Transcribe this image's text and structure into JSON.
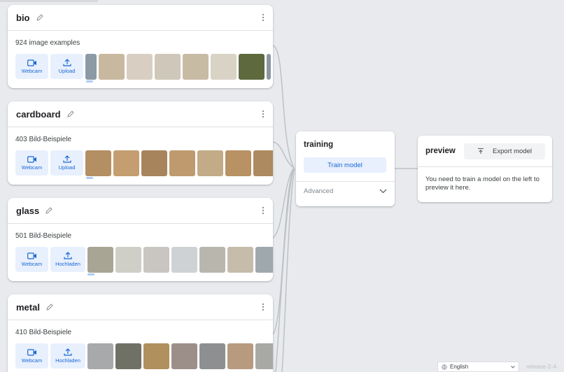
{
  "classes": [
    {
      "name": "bio",
      "count": "924 image examples",
      "webcam": "Webcam",
      "upload": "Upload",
      "thumbs": [
        "#8c9aa6",
        "#c9b8a0",
        "#d8cfc2",
        "#cfc7b9",
        "#c8bba4",
        "#d9d3c6",
        "#5e6a3e",
        "#8b97a0"
      ]
    },
    {
      "name": "cardboard",
      "count": "403 Bild-Beispiele",
      "webcam": "Webcam",
      "upload": "Upload",
      "thumbs": [
        "#b48f63",
        "#c49e70",
        "#a8845c",
        "#bf9a6e",
        "#c2ab86",
        "#b89263",
        "#ad8a5f"
      ]
    },
    {
      "name": "glass",
      "count": "501 Bild-Beispiele",
      "webcam": "Webcam",
      "upload": "Hochladen",
      "thumbs": [
        "#a8a594",
        "#cfcfc8",
        "#c9c6c2",
        "#cfd2d4",
        "#b9b6ad",
        "#c6bcaa",
        "#9fa8ad"
      ]
    },
    {
      "name": "metal",
      "count": "410 Bild-Beispiele",
      "webcam": "Webcam",
      "upload": "Hochladen",
      "thumbs": [
        "#a7a9ab",
        "#6f7166",
        "#b0905c",
        "#9c8f8a",
        "#8e8f91",
        "#b89a7f",
        "#a8a8a4"
      ]
    }
  ],
  "training": {
    "title": "training",
    "train_button": "Train model",
    "advanced": "Advanced"
  },
  "preview": {
    "title": "preview",
    "export_button": "Export model",
    "message": "You need to train a model on the left to preview it here."
  },
  "footer": {
    "language": "English",
    "release": "release-2-4-"
  },
  "colors": {
    "accent": "#1967d2",
    "accent_bg": "#e8f0fe",
    "background": "#e8eaed"
  }
}
